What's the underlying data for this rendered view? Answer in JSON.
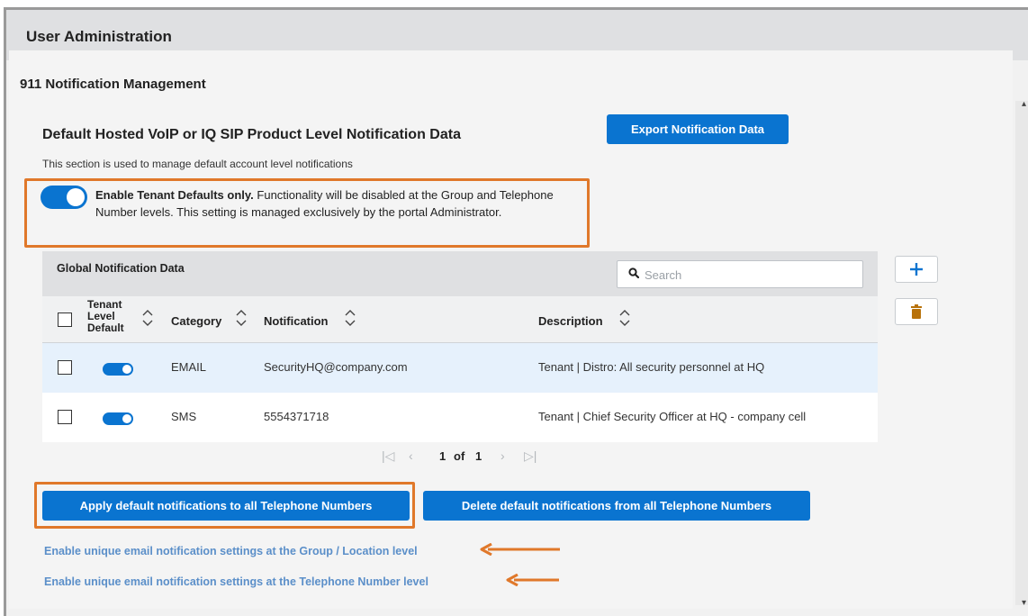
{
  "header": {
    "title": "User Administration"
  },
  "section": {
    "title": "911 Notification Management"
  },
  "defaults": {
    "title": "Default Hosted VoIP or IQ SIP Product Level Notification Data",
    "description": "This section is used to manage default account level notifications",
    "export_label": "Export Notification Data",
    "toggle_enabled": true,
    "tenant_bold": "Enable Tenant Defaults only.",
    "tenant_text": " Functionality will be disabled at the Group and Telephone Number levels. This setting is managed exclusively by the portal Administrator."
  },
  "grid": {
    "title": "Global Notification Data",
    "search_placeholder": "Search",
    "columns": {
      "tenant_line1": "Tenant",
      "tenant_line2": "Level",
      "tenant_line3": "Default",
      "category": "Category",
      "notification": "Notification",
      "description": "Description"
    },
    "rows": [
      {
        "tenant_default": true,
        "category": "EMAIL",
        "notification": "SecurityHQ@company.com",
        "description": "Tenant | Distro: All security personnel at HQ"
      },
      {
        "tenant_default": true,
        "category": "SMS",
        "notification": "5554371718",
        "description": "Tenant | Chief Security Officer at HQ - company cell"
      }
    ],
    "pager": {
      "current": "1",
      "of": "of",
      "total": "1"
    }
  },
  "actions": {
    "apply_label": "Apply default notifications to all Telephone Numbers",
    "delete_label": "Delete default notifications from all Telephone Numbers"
  },
  "links": {
    "group_location": "Enable unique email notification settings at the Group / Location level",
    "telephone_number": "Enable unique email notification settings at the Telephone Number level"
  },
  "colors": {
    "accent": "#0a74d0",
    "highlight": "#e0782a",
    "link": "#5b8fc9",
    "delete_icon": "#b8720a"
  }
}
